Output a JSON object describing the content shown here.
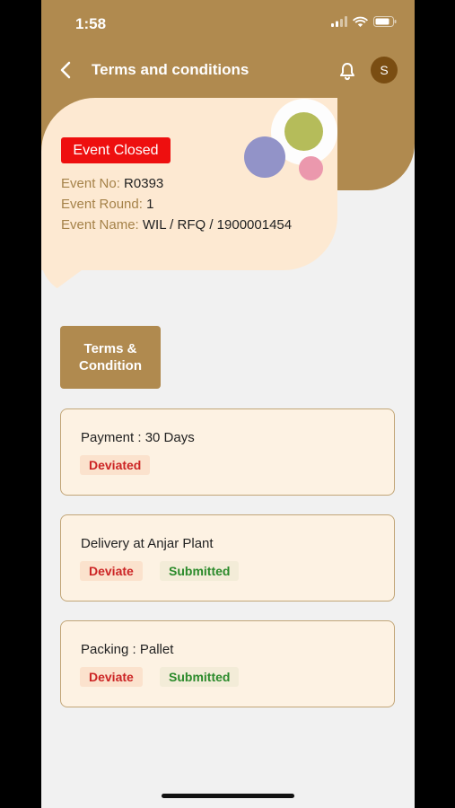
{
  "status_bar": {
    "time": "1:58",
    "icons": [
      "signal-icon",
      "wifi-icon",
      "battery-icon"
    ]
  },
  "nav": {
    "title": "Terms and conditions",
    "avatar_initial": "S",
    "icons": [
      "back-chevron-icon",
      "bell-icon"
    ]
  },
  "event": {
    "status": "Event Closed",
    "no_label": "Event No:",
    "no_value": "R0393",
    "round_label": "Event Round:",
    "round_value": "1",
    "name_label": "Event Name:",
    "name_value": "WIL / RFQ / 1900001454"
  },
  "tc_button": {
    "line1": "Terms &",
    "line2": "Condition"
  },
  "terms": [
    {
      "title": "Payment : 30 Days",
      "tags": [
        "Deviated"
      ]
    },
    {
      "title": "Delivery at Anjar Plant",
      "tags": [
        "Deviate",
        "Submitted"
      ]
    },
    {
      "title": "Packing : Pallet",
      "tags": [
        "Deviate",
        "Submitted"
      ]
    }
  ],
  "colors": {
    "brand": "#b08a4f",
    "card_bg": "#fde9d2",
    "closed_badge": "#ee0f0f",
    "deviate_text": "#cc2424",
    "submitted_text": "#2a8a2a",
    "avatar_bg": "#7a4d12",
    "deco_green": "#b5bc5a",
    "deco_purple": "#9293c8",
    "deco_pink": "#eb98ad"
  }
}
